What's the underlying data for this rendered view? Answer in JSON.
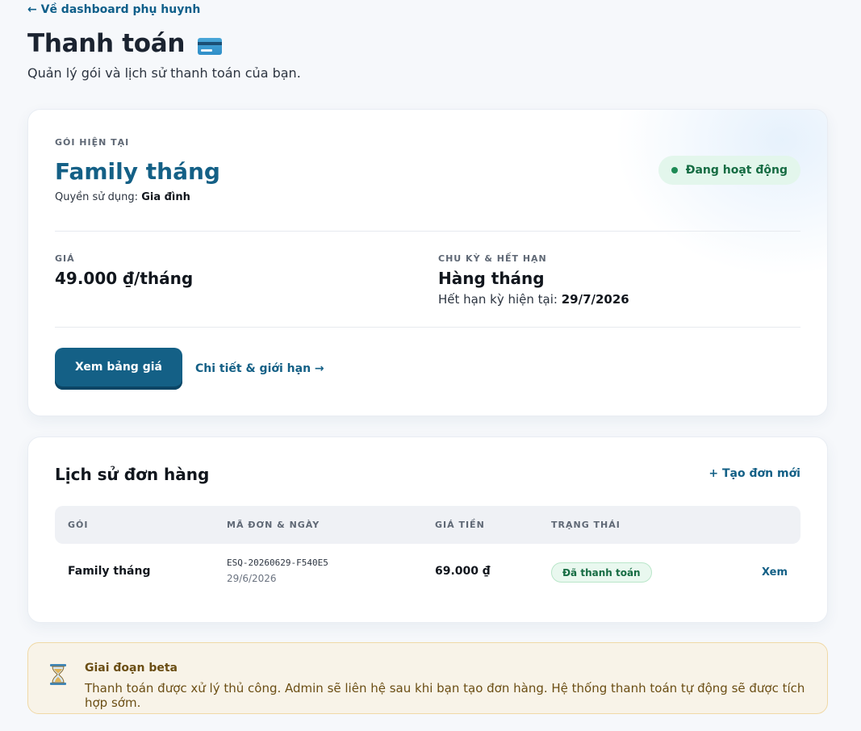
{
  "nav": {
    "back_label": "← Về dashboard phụ huynh"
  },
  "header": {
    "title": "Thanh toán",
    "title_icon": "credit-card-icon",
    "subtitle": "Quản lý gói và lịch sử thanh toán của bạn."
  },
  "plan": {
    "eyebrow": "GÓI HIỆN TẠI",
    "name": "Family tháng",
    "rights_label": "Quyền sử dụng:",
    "rights_value": "Gia đình",
    "status": "Đang hoạt động",
    "price_label": "GIÁ",
    "price_value": "49.000 ₫/tháng",
    "cycle_label": "CHU KỲ & HẾT HẠN",
    "cycle_value": "Hàng tháng",
    "expiry_label": "Hết hạn kỳ hiện tại:",
    "expiry_value": "29/7/2026",
    "primary_button": "Xem bảng giá",
    "details_link": "Chi tiết & giới hạn →"
  },
  "orders": {
    "title": "Lịch sử đơn hàng",
    "new_order": "+ Tạo đơn mới",
    "columns": [
      "GÓI",
      "MÃ ĐƠN & NGÀY",
      "GIÁ TIỀN",
      "TRẠNG THÁI"
    ],
    "rows": [
      {
        "plan": "Family tháng",
        "code": "ESQ-20260629-F540E5",
        "date": "29/6/2026",
        "price": "69.000 ₫",
        "status": "Đã thanh toán",
        "action": "Xem"
      }
    ]
  },
  "beta": {
    "icon": "hourglass-icon",
    "title": "Giai đoạn beta",
    "text": "Thanh toán được xử lý thủ công. Admin sẽ liên hệ sau khi bạn tạo đơn hàng. Hệ thống thanh toán tự động sẽ được tích hợp sớm."
  },
  "colors": {
    "brand": "#146086",
    "status_green": "#1e8a55",
    "beta_bg": "#f8f3e8"
  }
}
